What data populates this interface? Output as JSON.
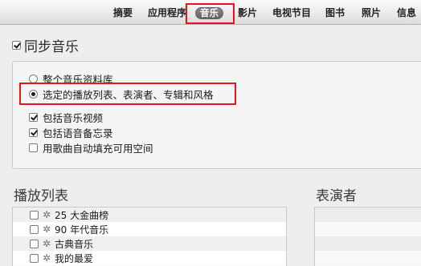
{
  "tabs": [
    {
      "label": "摘要",
      "active": false
    },
    {
      "label": "应用程序",
      "active": false
    },
    {
      "label": "音乐",
      "active": true
    },
    {
      "label": "影片",
      "active": false
    },
    {
      "label": "电视节目",
      "active": false
    },
    {
      "label": "图书",
      "active": false
    },
    {
      "label": "照片",
      "active": false
    },
    {
      "label": "信息",
      "active": false
    }
  ],
  "sync": {
    "title": "同步音乐",
    "checked": true,
    "options": [
      {
        "type": "radio",
        "label": "整个音乐资料库",
        "checked": false
      },
      {
        "type": "radio",
        "label": "选定的播放列表、表演者、专辑和风格",
        "checked": true
      },
      {
        "type": "checkbox",
        "label": "包括音乐视频",
        "checked": true
      },
      {
        "type": "checkbox",
        "label": "包括语音备忘录",
        "checked": true
      },
      {
        "type": "checkbox",
        "label": "用歌曲自动填充可用空间",
        "checked": false
      }
    ]
  },
  "playlists": {
    "title": "播放列表",
    "items": [
      {
        "label": "25 大金曲榜",
        "checked": false,
        "icon": "gear-icon"
      },
      {
        "label": "90 年代音乐",
        "checked": false,
        "icon": "gear-icon"
      },
      {
        "label": "古典音乐",
        "checked": false,
        "icon": "gear-icon"
      },
      {
        "label": "我的最爱",
        "checked": false,
        "icon": "gear-icon"
      }
    ]
  },
  "artists": {
    "title": "表演者"
  },
  "colors": {
    "highlight": "#e8141b",
    "active_tab": "#6f6f6f",
    "background": "#eeeeee"
  }
}
